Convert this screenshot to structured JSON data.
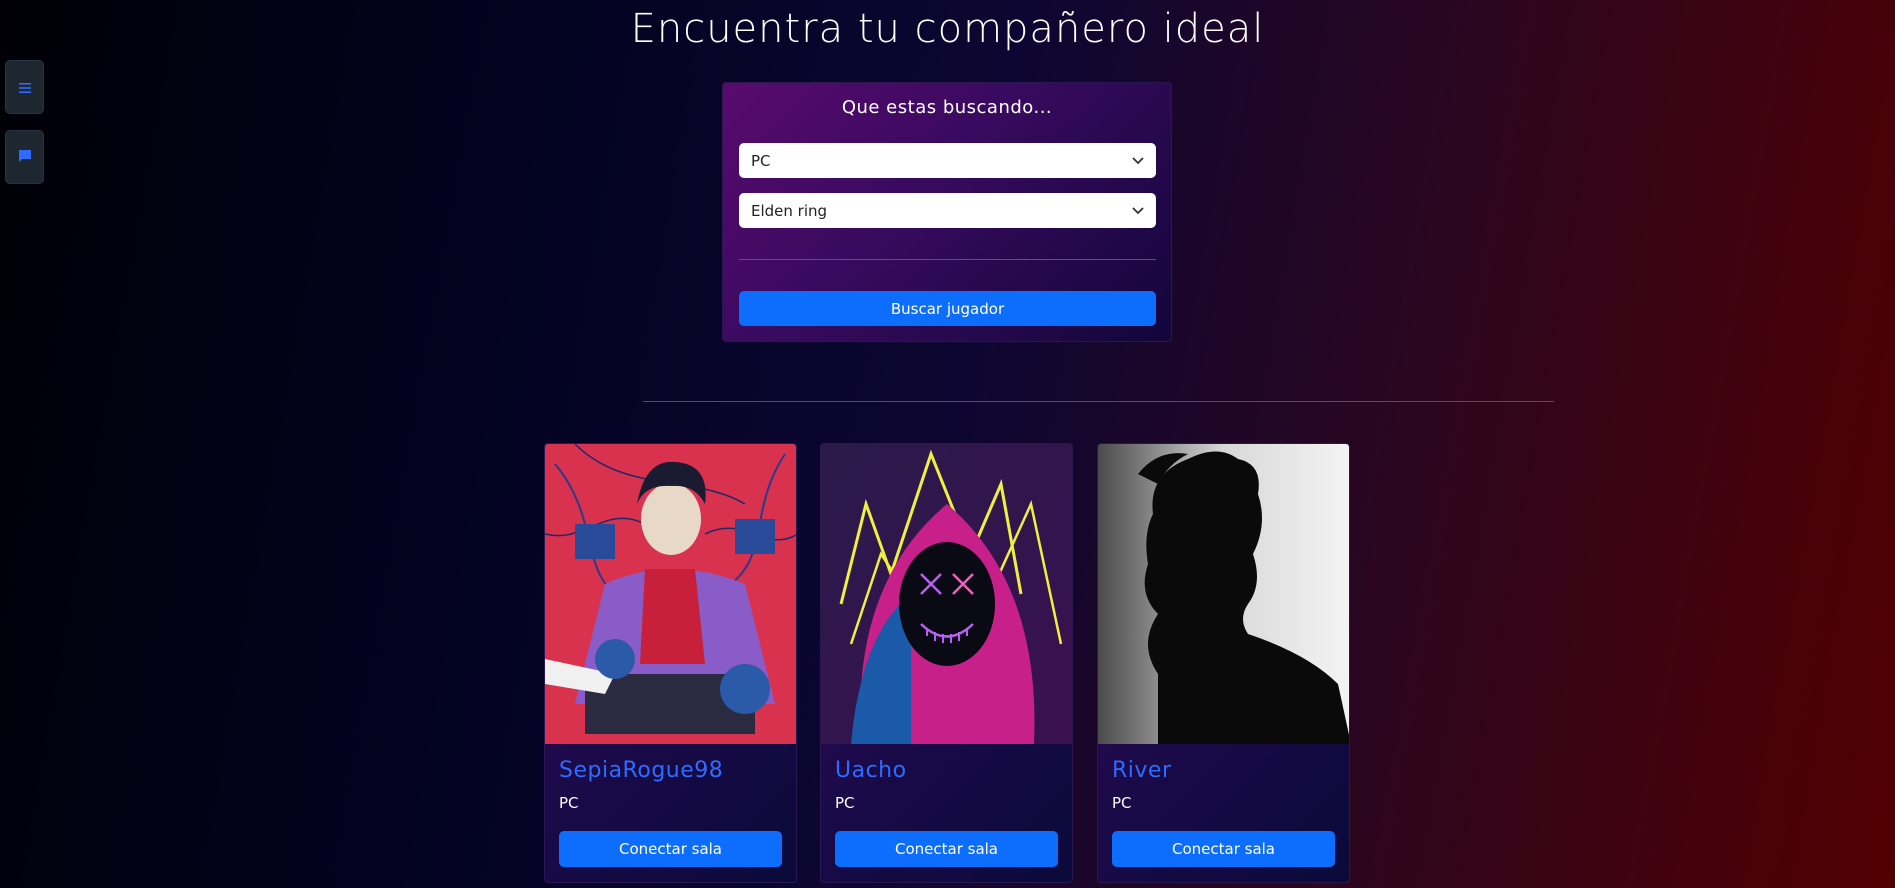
{
  "page": {
    "title": "Encuentra tu compañero ideal"
  },
  "sidebar": {
    "menu_icon": "hamburger-icon",
    "chat_icon": "chat-bubble-icon"
  },
  "search": {
    "heading": "Que estas buscando...",
    "platform_value": "PC",
    "game_value": "Elden ring",
    "button_label": "Buscar jugador"
  },
  "players": [
    {
      "name": "SepiaRogue98",
      "platform": "PC",
      "button_label": "Conectar sala",
      "image": "anime-character-avatar"
    },
    {
      "name": "Uacho",
      "platform": "PC",
      "button_label": "Conectar sala",
      "image": "neon-mask-hood-avatar"
    },
    {
      "name": "River",
      "platform": "PC",
      "button_label": "Conectar sala",
      "image": "silhouette-avatar"
    }
  ],
  "colors": {
    "accent": "#0d6efd",
    "player_name": "#2f6bff",
    "panel_purple": "#5a0a6e"
  }
}
